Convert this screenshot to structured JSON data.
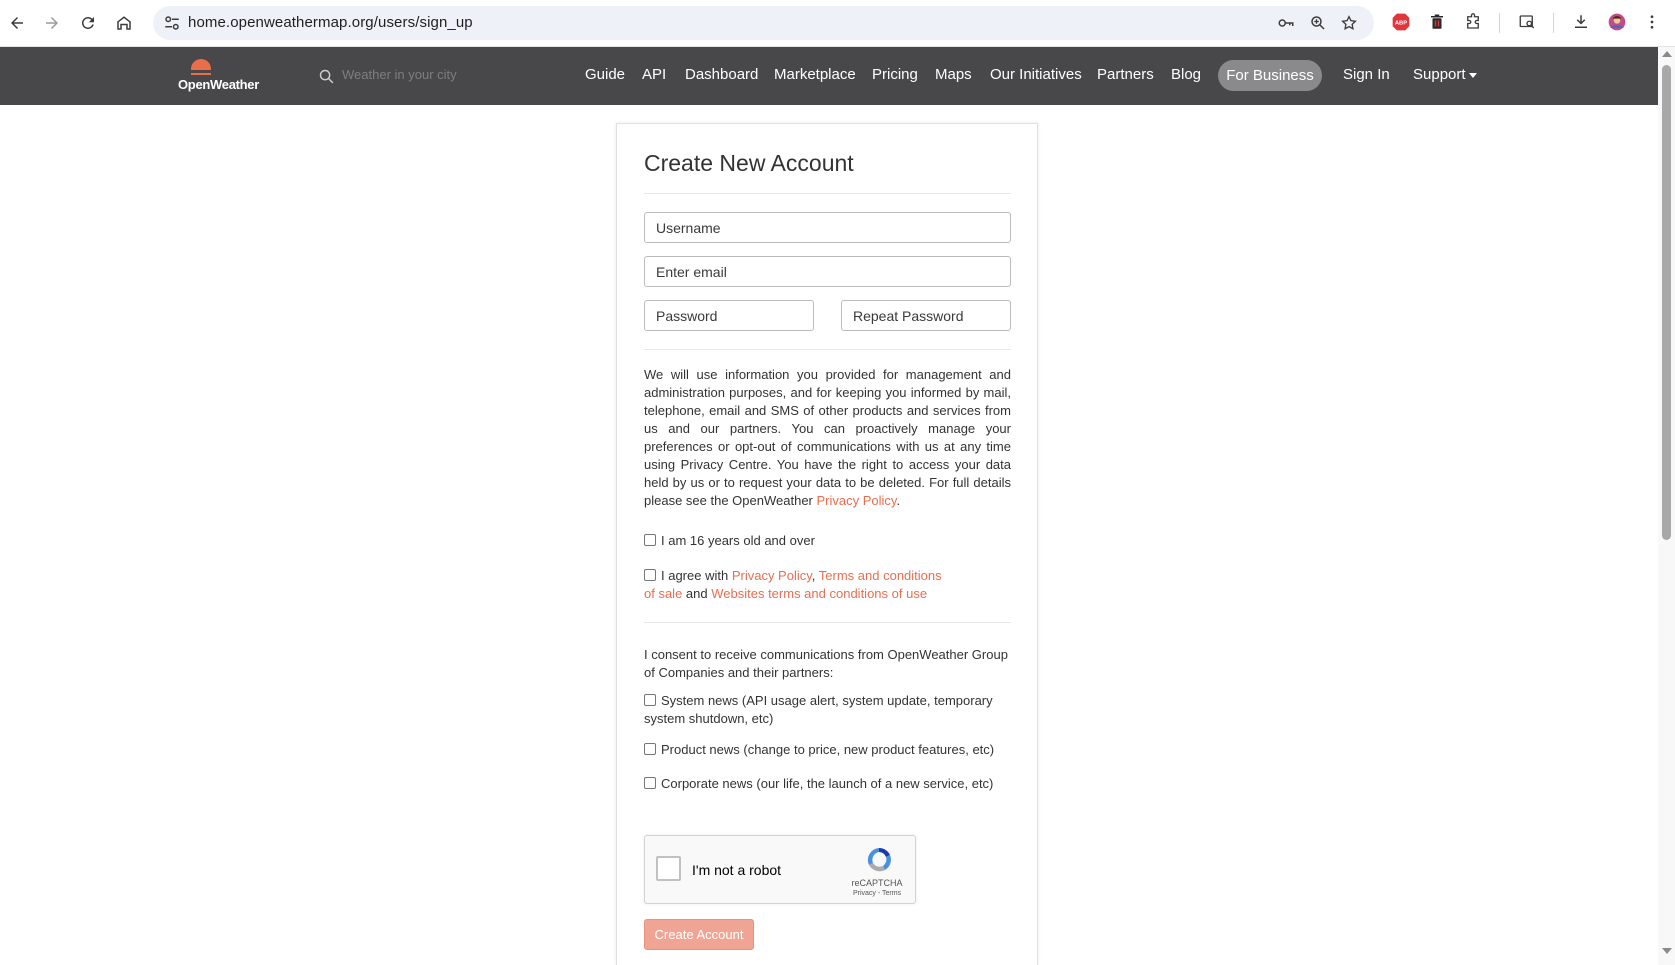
{
  "browser": {
    "url": "home.openweathermap.org/users/sign_up"
  },
  "site_nav": {
    "logo_text": "OpenWeather",
    "search_placeholder": "Weather in your city",
    "links": [
      "Guide",
      "API",
      "Dashboard",
      "Marketplace",
      "Pricing",
      "Maps",
      "Our Initiatives",
      "Partners",
      "Blog"
    ],
    "business_label": "For Business",
    "sign_in_label": "Sign In",
    "support_label": "Support",
    "accent_color": "#e96e50",
    "nav_bg_color": "#48484a"
  },
  "form": {
    "title": "Create New Account",
    "username_placeholder": "Username",
    "email_placeholder": "Enter email",
    "password_placeholder": "Password",
    "repeat_password_placeholder": "Repeat Password",
    "policy_text": "We will use information you provided for management and administration purposes, and for keeping you informed by mail, telephone, email and SMS of other products and services from us and our partners. You can proactively manage your preferences or opt-out of communications with us at any time using Privacy Centre. You have the right to access your data held by us or to request your data to be deleted. For full details please see the OpenWeather ",
    "policy_link": "Privacy Policy",
    "policy_end": ".",
    "age_label": "I am 16 years old and over",
    "agree_prefix": "I agree with ",
    "agree_privacy_link": "Privacy Policy",
    "agree_comma": ", ",
    "agree_terms_link": "Terms and conditions of sale",
    "agree_and": " and ",
    "agree_websites_link": "Websites terms and conditions of use",
    "consent_text": "I consent to receive communications from OpenWeather Group of Companies and their partners:",
    "system_news_label": "System news (API usage alert, system update, temporary system shutdown, etc)",
    "product_news_label": "Product news (change to price, new product features, etc)",
    "corporate_news_label": "Corporate news (our life, the launch of a new service, etc)",
    "captcha_label": "I'm not a robot",
    "captcha_brand": "reCAPTCHA",
    "captcha_links": "Privacy - Terms",
    "submit_label": "Create Account"
  }
}
